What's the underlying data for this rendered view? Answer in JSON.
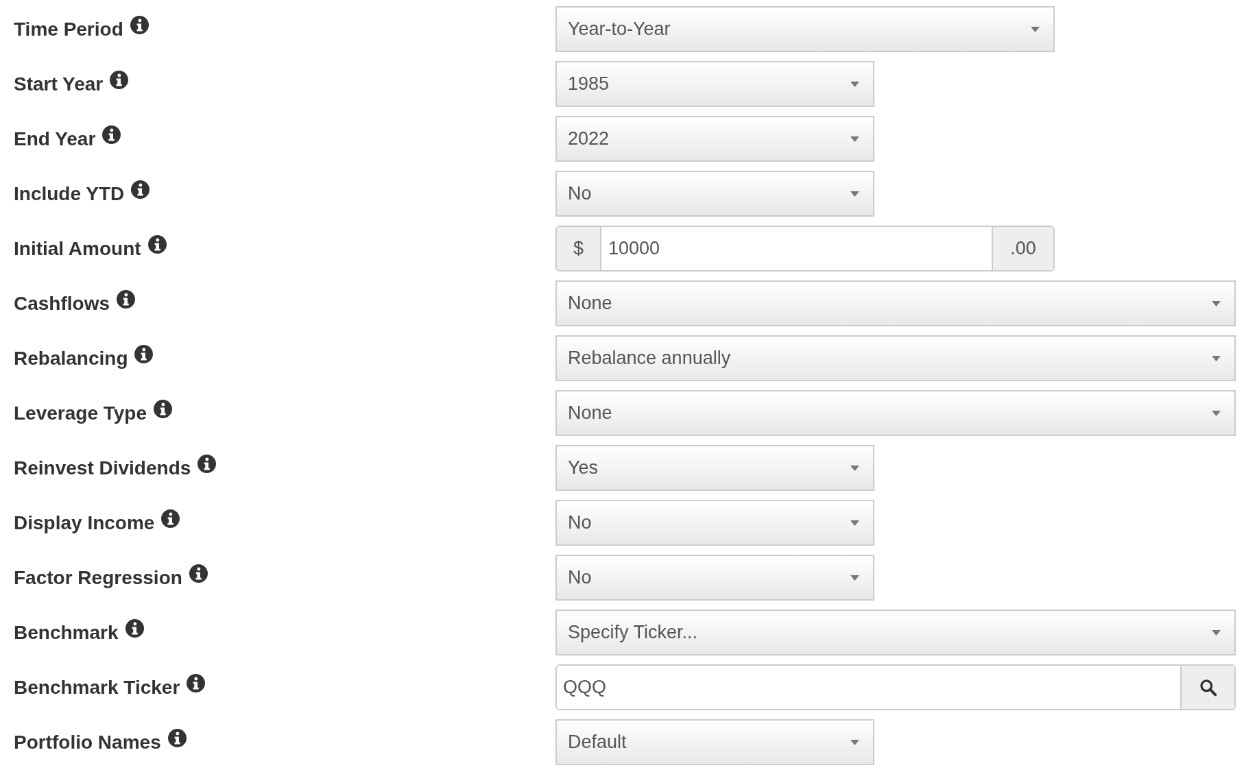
{
  "fields": [
    {
      "kind": "select",
      "label": "Time Period",
      "value": "Year-to-Year"
    },
    {
      "kind": "select",
      "label": "Start Year",
      "value": "1985"
    },
    {
      "kind": "select",
      "label": "End Year",
      "value": "2022"
    },
    {
      "kind": "select",
      "label": "Include YTD",
      "value": "No"
    },
    {
      "kind": "currency",
      "label": "Initial Amount",
      "prefix": "$",
      "value": "10000",
      "suffix": ".00"
    },
    {
      "kind": "select",
      "label": "Cashflows",
      "value": "None"
    },
    {
      "kind": "select",
      "label": "Rebalancing",
      "value": "Rebalance annually"
    },
    {
      "kind": "select",
      "label": "Leverage Type",
      "value": "None"
    },
    {
      "kind": "select",
      "label": "Reinvest Dividends",
      "value": "Yes"
    },
    {
      "kind": "select",
      "label": "Display Income",
      "value": "No"
    },
    {
      "kind": "select",
      "label": "Factor Regression",
      "value": "No"
    },
    {
      "kind": "select",
      "label": "Benchmark",
      "value": "Specify Ticker..."
    },
    {
      "kind": "search",
      "label": "Benchmark Ticker",
      "value": "QQQ"
    },
    {
      "kind": "select",
      "label": "Portfolio Names",
      "value": "Default"
    }
  ]
}
